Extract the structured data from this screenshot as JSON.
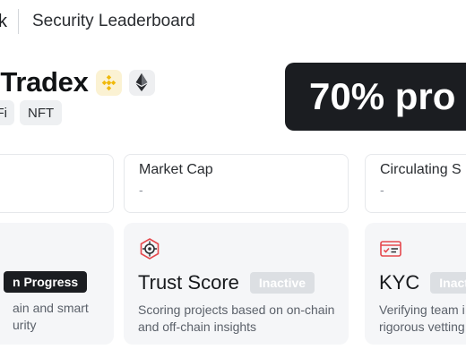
{
  "header": {
    "brand_tail": "k",
    "breadcrumb": "Security Leaderboard"
  },
  "project": {
    "name": "roTradex",
    "chains": [
      {
        "icon": "bnb-chain-icon",
        "color": "#F0B90B"
      },
      {
        "icon": "ethereum-icon",
        "color": "#2b2d31"
      }
    ],
    "tags": [
      "Fi",
      "NFT"
    ]
  },
  "banner": {
    "text": "70% pro"
  },
  "stats": [
    {
      "label": "",
      "value": ""
    },
    {
      "label": "Market Cap",
      "value": "-"
    },
    {
      "label": "Circulating S",
      "value": "-"
    }
  ],
  "features": [
    {
      "title": "",
      "badge": "n Progress",
      "badge_state": "in-progress",
      "desc_lines": [
        "ain and smart",
        "urity"
      ]
    },
    {
      "title": "Trust Score",
      "badge": "Inactive",
      "badge_state": "inactive",
      "desc_lines": [
        "Scoring projects based on on-chain",
        "and off-chain insights"
      ],
      "icon": "trust-target-icon"
    },
    {
      "title": "KYC",
      "badge": "Inact",
      "badge_state": "inactive",
      "desc_lines": [
        "Verifying team i",
        "rigorous vetting"
      ],
      "icon": "id-card-icon"
    }
  ],
  "colors": {
    "banner_bg": "#1b1d21",
    "badge_inactive": "#dcdfe3",
    "card_bg": "#f5f6f8",
    "accent_red": "#e5484d"
  }
}
